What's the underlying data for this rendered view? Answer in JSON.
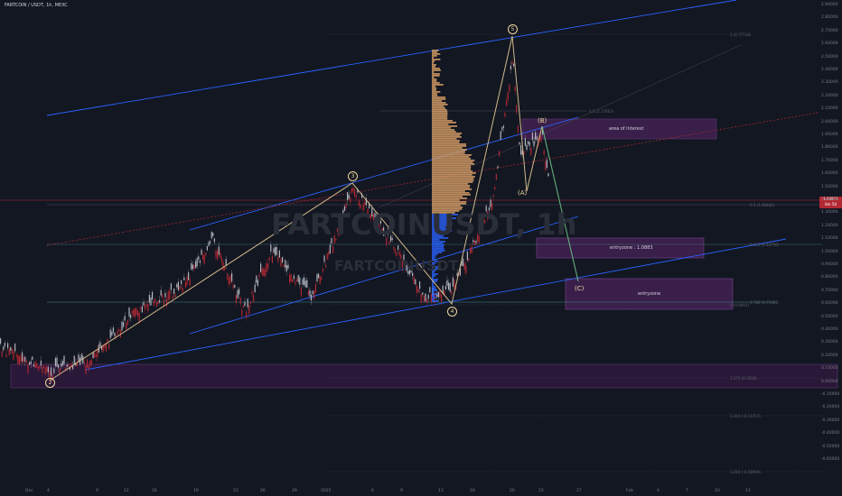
{
  "symbol_title": "FARTCOIN / USDT, 1h, MEXC",
  "watermark": {
    "big": "FARTCOINUSDT, 1h",
    "small": "FARTCOINUSDT"
  },
  "price_tag": {
    "line1": "1.48971",
    "line2": "8m 58"
  },
  "zones": [
    {
      "label": "area of Interest"
    },
    {
      "label": "entryzone : 1.0883"
    },
    {
      "label": "entryzone"
    }
  ],
  "wave_labels": {
    "w2": "2",
    "w3": "3",
    "w4": "4",
    "w5": "5",
    "wa": "(A)",
    "wb": "(B)",
    "wc": "(C)"
  },
  "fib_labels": [
    "1 (2.77518)",
    "0.5 (2.17603)",
    "0.5 (1.48482)",
    "0.618 (1.14776)",
    "0.786 (0.71681)",
    "0 (0.6991)",
    "1.272 (0.1818)",
    "1.414 (-0.16707)",
    "1.618 (-0.58996)"
  ],
  "price_axis": [
    "2.90000",
    "2.80000",
    "2.70000",
    "2.60000",
    "2.50000",
    "2.40000",
    "2.30000",
    "2.20000",
    "2.10000",
    "2.00000",
    "1.90000",
    "1.80000",
    "1.70000",
    "1.60000",
    "1.50000",
    "1.40000",
    "1.30000",
    "1.20000",
    "1.10000",
    "1.00000",
    "0.90000",
    "0.80000",
    "0.70000",
    "0.60000",
    "0.50000",
    "0.40000",
    "0.30000",
    "0.20000",
    "0.10000",
    "0.00000",
    "-0.10000",
    "-0.20000",
    "-0.30000",
    "-0.40000",
    "-0.50000",
    "-0.60000"
  ],
  "time_axis": [
    "Dec",
    "4",
    "9",
    "12",
    "16",
    "19",
    "23",
    "26",
    "29",
    "2025",
    "6",
    "9",
    "13",
    "16",
    "20",
    "23",
    "27",
    "Feb",
    "4",
    "7",
    "10",
    "13"
  ],
  "colors": {
    "background": "#131722",
    "channel": "#2962ff",
    "wave": "#d1b98a",
    "zone": "#3a1f4a",
    "volume_profile": "#d9a066",
    "volume_profile_alt": "#2962ff",
    "candle_up": "#b2b5be",
    "candle_down": "#b22833",
    "dotted_red": "#b22833"
  }
}
